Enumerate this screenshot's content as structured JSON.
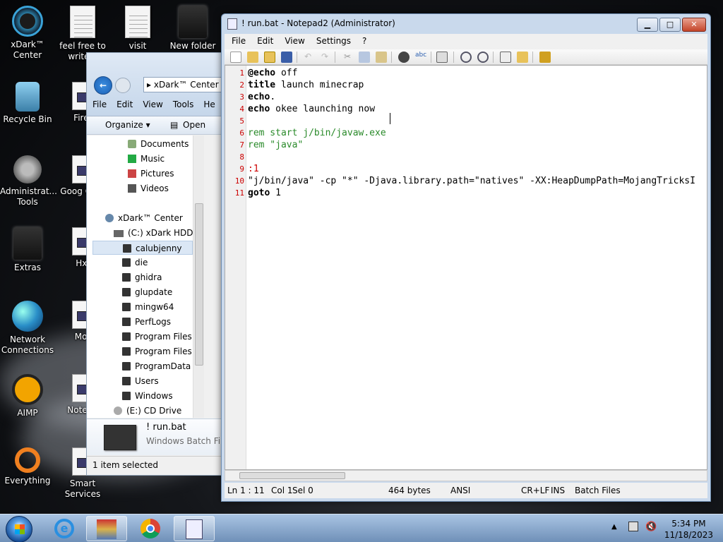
{
  "desktop": {
    "icons": [
      {
        "label": "xDark™ Center",
        "icon": "xdark-icon"
      },
      {
        "label": "feel free to write a",
        "icon": "text-document-icon"
      },
      {
        "label": "visit",
        "icon": "text-document-icon"
      },
      {
        "label": "New folder",
        "icon": "folder-icon"
      },
      {
        "label": "Recycle Bin",
        "icon": "recycle-bin-icon"
      },
      {
        "label": "Firef",
        "icon": "batch-file-icon"
      },
      {
        "label": "Administrat... Tools",
        "icon": "admin-tools-icon"
      },
      {
        "label": "Goog Chro",
        "icon": "batch-file-icon"
      },
      {
        "label": "Extras",
        "icon": "folder-icon"
      },
      {
        "label": "Hxl",
        "icon": "batch-file-icon"
      },
      {
        "label": "Network Connections",
        "icon": "network-globe-icon"
      },
      {
        "label": "Mot",
        "icon": "batch-file-icon"
      },
      {
        "label": "AIMP",
        "icon": "aimp-icon"
      },
      {
        "label": "Notepa",
        "icon": "batch-file-icon"
      },
      {
        "label": "Everything",
        "icon": "everything-icon"
      },
      {
        "label": "Smart Services",
        "icon": "batch-file-icon"
      }
    ]
  },
  "explorer": {
    "address": "xDark™ Center",
    "menu": [
      "File",
      "Edit",
      "View",
      "Tools",
      "He"
    ],
    "toolbar": {
      "organize": "Organize ▾",
      "open": "Open"
    },
    "tree": [
      {
        "label": "Documents",
        "icon": "lib"
      },
      {
        "label": "Music",
        "icon": "music"
      },
      {
        "label": "Pictures",
        "icon": "pic"
      },
      {
        "label": "Videos",
        "icon": "vid"
      },
      {
        "label": "xDark™ Center",
        "icon": "home"
      },
      {
        "label": "(C:) xDark HDD",
        "icon": "drive"
      },
      {
        "label": "calubjenny",
        "icon": "folder"
      },
      {
        "label": "die",
        "icon": "folder"
      },
      {
        "label": "ghidra",
        "icon": "folder"
      },
      {
        "label": "glupdate",
        "icon": "folder"
      },
      {
        "label": "mingw64",
        "icon": "folder"
      },
      {
        "label": "PerfLogs",
        "icon": "folder"
      },
      {
        "label": "Program Files",
        "icon": "folder"
      },
      {
        "label": "Program Files (",
        "icon": "folder"
      },
      {
        "label": "ProgramData",
        "icon": "folder"
      },
      {
        "label": "Users",
        "icon": "folder"
      },
      {
        "label": "Windows",
        "icon": "folder"
      },
      {
        "label": "(E:) CD Drive",
        "icon": "cd"
      }
    ],
    "selected_item": "calubjenny",
    "details": {
      "name": "! run.bat",
      "type": "Windows Batch File"
    },
    "status": "1 item selected"
  },
  "notepad": {
    "title": "! run.bat - Notepad2 (Administrator)",
    "menu": [
      "File",
      "Edit",
      "View",
      "Settings",
      "?"
    ],
    "lines": [
      {
        "n": "1",
        "text": "@echo off"
      },
      {
        "n": "2",
        "text": "title launch minecrap"
      },
      {
        "n": "3",
        "text": "echo."
      },
      {
        "n": "4",
        "text": "echo okee launching now"
      },
      {
        "n": "5",
        "text": ""
      },
      {
        "n": "6",
        "text": "rem start j/bin/javaw.exe"
      },
      {
        "n": "7",
        "text": "rem \"java\""
      },
      {
        "n": "8",
        "text": ""
      },
      {
        "n": "9",
        "text": ":1"
      },
      {
        "n": "10",
        "text": "\"j/bin/java\" -cp \"*\" -Djava.library.path=\"natives\" -XX:HeapDumpPath=MojangTricksI"
      },
      {
        "n": "11",
        "text": "goto 1"
      }
    ],
    "status": {
      "position": "Ln 1 : 11",
      "col": "Col 1",
      "sel": "Sel 0",
      "size": "464 bytes",
      "encoding": "ANSI",
      "eol": "CR+LF",
      "mode": "INS",
      "scheme": "Batch Files"
    }
  },
  "taskbar": {
    "time": "5:34 PM",
    "date": "11/18/2023",
    "apps": [
      "start-orb",
      "internet-explorer-icon",
      "archive-icon",
      "chrome-icon",
      "notepad2-icon"
    ]
  },
  "colors": {
    "accent": "#1a5fb4",
    "line_numbers": "#cc0000",
    "comment": "#2a8a2a"
  }
}
